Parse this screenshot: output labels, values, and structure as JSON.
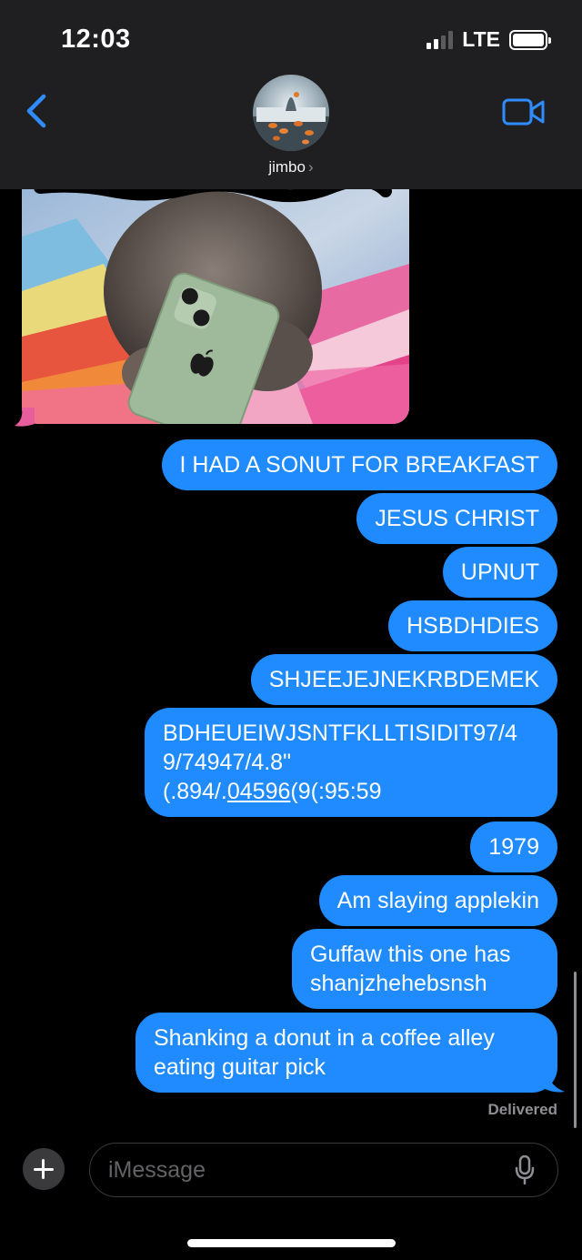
{
  "status_bar": {
    "time": "12:03",
    "network": "LTE"
  },
  "header": {
    "contact_name": "jimbo",
    "chevron": "›"
  },
  "messages": [
    {
      "lines": [
        "I HAD A SONUT FOR BREAKFAST"
      ]
    },
    {
      "lines": [
        "JESUS CHRIST"
      ]
    },
    {
      "lines": [
        "UPNUT"
      ]
    },
    {
      "lines": [
        "HSBDHDIES"
      ]
    },
    {
      "lines": [
        "SHJEEJEJNEKRBDEMEK"
      ]
    },
    {
      "line1": "BDHEUEIWJSNTFKLLTISIDIT97/4",
      "line2": "9/74947/4.8\"",
      "line3_prefix": "(.894/.",
      "line3_link": "04596",
      "line3_suffix": "(9(:95:59"
    },
    {
      "lines": [
        "1979"
      ]
    },
    {
      "lines": [
        "Am slaying applekin"
      ]
    },
    {
      "lines": [
        "Guffaw this one has",
        "shanjzhehebsnsh"
      ]
    },
    {
      "lines": [
        "Shanking a donut in a coffee alley",
        "eating guitar pick"
      ]
    }
  ],
  "delivered": "Delivered",
  "composer": {
    "placeholder": "iMessage"
  },
  "colors": {
    "bubble_blue": "#1f8bff",
    "header_bg": "#1f1f21",
    "accent": "#2f8cff"
  },
  "icons": [
    "back-chevron-icon",
    "video-camera-icon",
    "plus-icon",
    "microphone-icon",
    "battery-icon",
    "signal-icon"
  ]
}
